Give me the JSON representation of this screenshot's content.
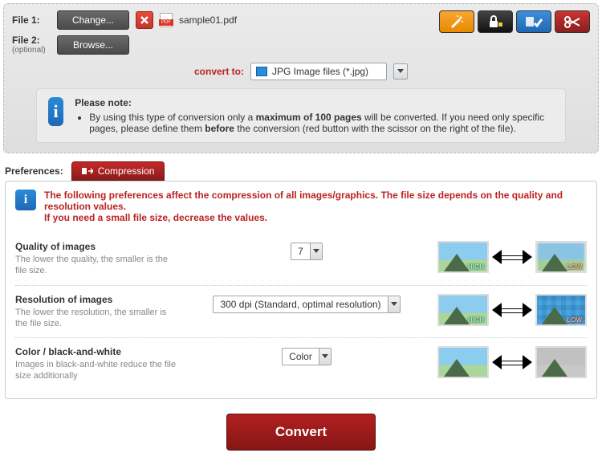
{
  "files": {
    "file1_label": "File 1:",
    "file2_label": "File 2:",
    "optional": "(optional)",
    "change_btn": "Change...",
    "browse_btn": "Browse...",
    "filename": "sample01.pdf"
  },
  "toolbar": {
    "magic": "magic-wand",
    "lock": "lock",
    "options": "options",
    "scissor": "scissor"
  },
  "convert": {
    "label": "convert to:",
    "format": "JPG Image files (*.jpg)"
  },
  "note": {
    "title": "Please note:",
    "bullet_pre": "By using this type of conversion only a ",
    "bullet_bold1": "maximum of 100 pages",
    "bullet_mid": " will be converted. If you need only specific pages, please define them ",
    "bullet_bold2": "before",
    "bullet_post": " the conversion (red button with the scissor on the right of the file)."
  },
  "prefs": {
    "header": "Preferences:",
    "tab": "Compression",
    "warn1": "The following preferences affect the compression of all images/graphics. The file size depends on the quality and resolution values.",
    "warn2": "If you need a small file size, decrease the values.",
    "quality": {
      "title": "Quality of images",
      "desc": "The lower the quality, the smaller is the file size.",
      "value": "7"
    },
    "resolution": {
      "title": "Resolution of images",
      "desc": "The lower the resolution, the smaller is the file size.",
      "value": "300 dpi (Standard, optimal resolution)"
    },
    "color": {
      "title": "Color / black-and-white",
      "desc": "Images in black-and-white reduce the file size additionally",
      "value": "Color"
    },
    "high": "HIGH",
    "low": "LOW"
  },
  "submit": "Convert"
}
